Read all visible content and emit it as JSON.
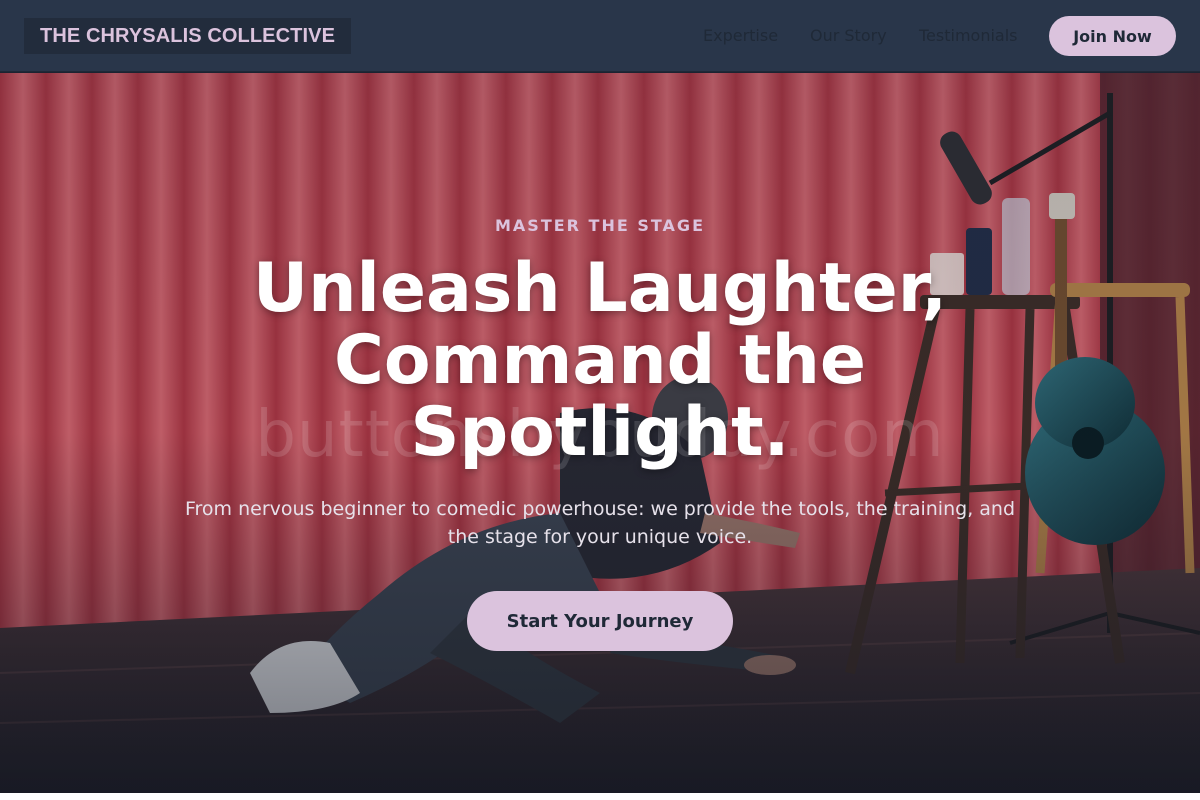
{
  "header": {
    "logo_text": "THE CHRYSALIS COLLECTIVE",
    "nav": [
      {
        "label": "Expertise"
      },
      {
        "label": "Our Story"
      },
      {
        "label": "Testimonials"
      }
    ],
    "cta_label": "Join Now"
  },
  "hero": {
    "background": "comedian-performing-on-stage-photo",
    "watermark": "buttonsbybuddy.com",
    "kicker": "MASTER THE STAGE",
    "headline": "Unleash Laughter, Command the Spotlight.",
    "subtext": "From nervous beginner to comedic powerhouse: we provide the tools, the training, and the stage for your unique voice.",
    "cta_label": "Start Your Journey"
  },
  "colors": {
    "header_bg": "#29364a",
    "accent": "#dbc3dd",
    "dark_text": "#1f2937",
    "curtain": "#b8434f"
  }
}
